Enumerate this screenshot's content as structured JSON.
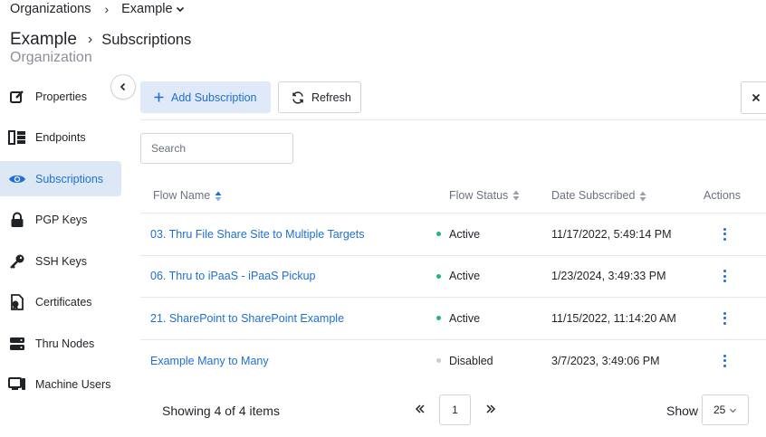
{
  "breadcrumb": {
    "root": "Organizations",
    "current": "Example"
  },
  "header": {
    "title": "Example",
    "section": "Subscriptions",
    "subtitle": "Organization"
  },
  "sidebar": {
    "items": [
      {
        "label": "Properties",
        "icon": "edit-icon",
        "active": false
      },
      {
        "label": "Endpoints",
        "icon": "endpoints-icon",
        "active": false
      },
      {
        "label": "Subscriptions",
        "icon": "eye-icon",
        "active": true
      },
      {
        "label": "PGP Keys",
        "icon": "lock-icon",
        "active": false
      },
      {
        "label": "SSH Keys",
        "icon": "key-icon",
        "active": false
      },
      {
        "label": "Certificates",
        "icon": "certificate-icon",
        "active": false
      },
      {
        "label": "Thru Nodes",
        "icon": "server-icon",
        "active": false
      },
      {
        "label": "Machine Users",
        "icon": "computer-icon",
        "active": false
      }
    ]
  },
  "toolbar": {
    "add_label": "Add Subscription",
    "refresh_label": "Refresh"
  },
  "search": {
    "placeholder": "Search",
    "value": ""
  },
  "table": {
    "columns": [
      "Flow Name",
      "Flow Status",
      "Date Subscribed",
      "Actions"
    ],
    "rows": [
      {
        "name": "03. Thru File Share Site to Multiple Targets",
        "status": "Active",
        "date": "11/17/2022, 5:49:14 PM"
      },
      {
        "name": "06. Thru to iPaaS - iPaaS Pickup",
        "status": "Active",
        "date": "1/23/2024, 3:49:33 PM"
      },
      {
        "name": "21. SharePoint to SharePoint Example",
        "status": "Active",
        "date": "11/15/2022, 11:14:20 AM"
      },
      {
        "name": "Example Many to Many",
        "status": "Disabled",
        "date": "3/7/2023, 3:49:06 PM"
      }
    ]
  },
  "footer": {
    "showing": "Showing 4 of 4 items",
    "page": "1",
    "show_label": "Show",
    "page_size": "25"
  },
  "colors": {
    "accent": "#1f6fd1",
    "active_bg": "#dde8f7",
    "status_active": "#22b573",
    "status_disabled": "#c8ccd2"
  }
}
